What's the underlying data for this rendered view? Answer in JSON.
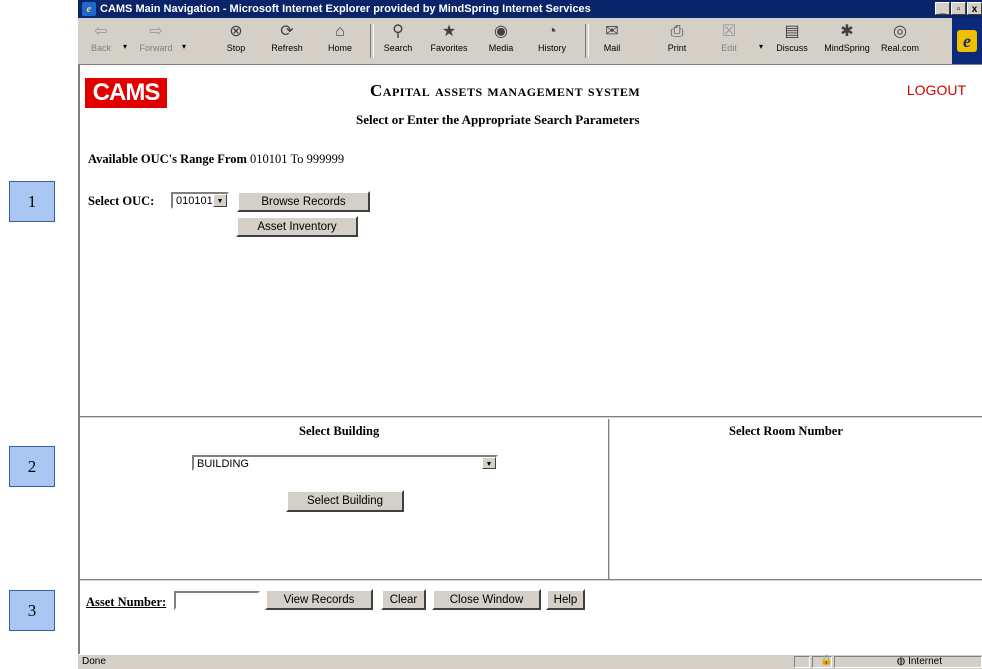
{
  "callouts": [
    "1",
    "2",
    "3"
  ],
  "window": {
    "title": "CAMS Main Navigation - Microsoft Internet Explorer provided by MindSpring Internet Services",
    "controls": [
      "_",
      "▫",
      "x"
    ]
  },
  "toolbar": {
    "back": "Back",
    "forward": "Forward",
    "stop": "Stop",
    "refresh": "Refresh",
    "home": "Home",
    "search": "Search",
    "favorites": "Favorites",
    "media": "Media",
    "history": "History",
    "mail": "Mail",
    "print": "Print",
    "edit": "Edit",
    "discuss": "Discuss",
    "mindspring": "MindSpring",
    "real": "Real.com"
  },
  "header": {
    "logo": "CAMS",
    "app_name": "Capital assets management system",
    "logout": "LOGOUT",
    "subtitle": "Select or Enter the Appropriate Search Parameters"
  },
  "ouc": {
    "range_label": "Available OUC's Range From",
    "range_from": "010101",
    "range_to_label": "To",
    "range_to": "999999",
    "select_label": "Select OUC:",
    "selected": "010101",
    "browse_button": "Browse Records",
    "inventory_button": "Asset Inventory"
  },
  "building": {
    "title": "Select Building",
    "selected": "BUILDING",
    "button": "Select Building"
  },
  "room": {
    "title": "Select Room Number"
  },
  "asset": {
    "label": "Asset Number:",
    "value": "",
    "view_button": "View Records",
    "clear_button": "Clear",
    "close_button": "Close Window",
    "help_button": "Help"
  },
  "status": {
    "text": "Done",
    "zone": "Internet"
  },
  "colors": {
    "logo_bg": "#e00000",
    "logout": "#cc0000",
    "titlebar": "#0a246a",
    "callout": "#aac6f2"
  }
}
